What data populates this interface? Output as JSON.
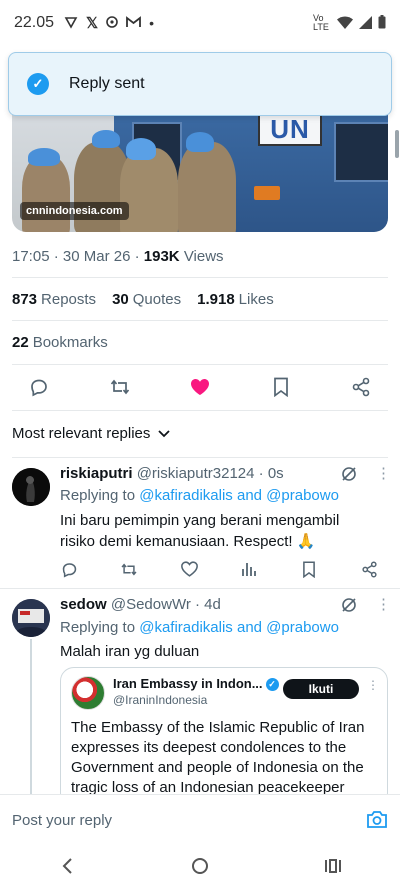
{
  "status_bar": {
    "time": "22.05",
    "network": "Vo LTE"
  },
  "toast": {
    "message": "Reply sent",
    "icon": "check-circle-icon"
  },
  "media": {
    "credit": "cnnindonesia.com",
    "sign": "UN"
  },
  "tweet": {
    "time": "17:05",
    "date": "30 Mar 26",
    "views_count": "193K",
    "views_label": "Views",
    "reposts_count": "873",
    "reposts_label": "Reposts",
    "quotes_count": "30",
    "quotes_label": "Quotes",
    "likes_count": "1.918",
    "likes_label": "Likes",
    "bookmarks_count": "22",
    "bookmarks_label": "Bookmarks",
    "liked": true,
    "colors": {
      "like": "#f91880",
      "accent": "#1d9bf0"
    }
  },
  "sort": {
    "label": "Most relevant replies"
  },
  "replies": [
    {
      "name": "riskiaputri",
      "handle": "@riskiaputr32124",
      "age": "· 0s",
      "replying_prefix": "Replying to",
      "replying_to": "@kafiradikalis and @prabowo",
      "text": "Ini baru pemimpin yang berani mengambil risiko demi kemanusiaan. Respect! 🙏"
    },
    {
      "name": "sedow",
      "handle": "@SedowWr",
      "age": "· 4d",
      "replying_prefix": "Replying to",
      "replying_to": "@kafiradikalis and @prabowo",
      "text": "Malah iran yg duluan",
      "quote": {
        "name": "Iran Embassy in Indon...",
        "handle": "@IraninIndonesia",
        "follow_label": "Ikuti",
        "text": "The Embassy of the Islamic Republic of Iran expresses its deepest condolences to the Government and people of Indonesia on the tragic loss of an Indonesian peacekeeper"
      }
    }
  ],
  "composer": {
    "placeholder": "Post your reply"
  }
}
